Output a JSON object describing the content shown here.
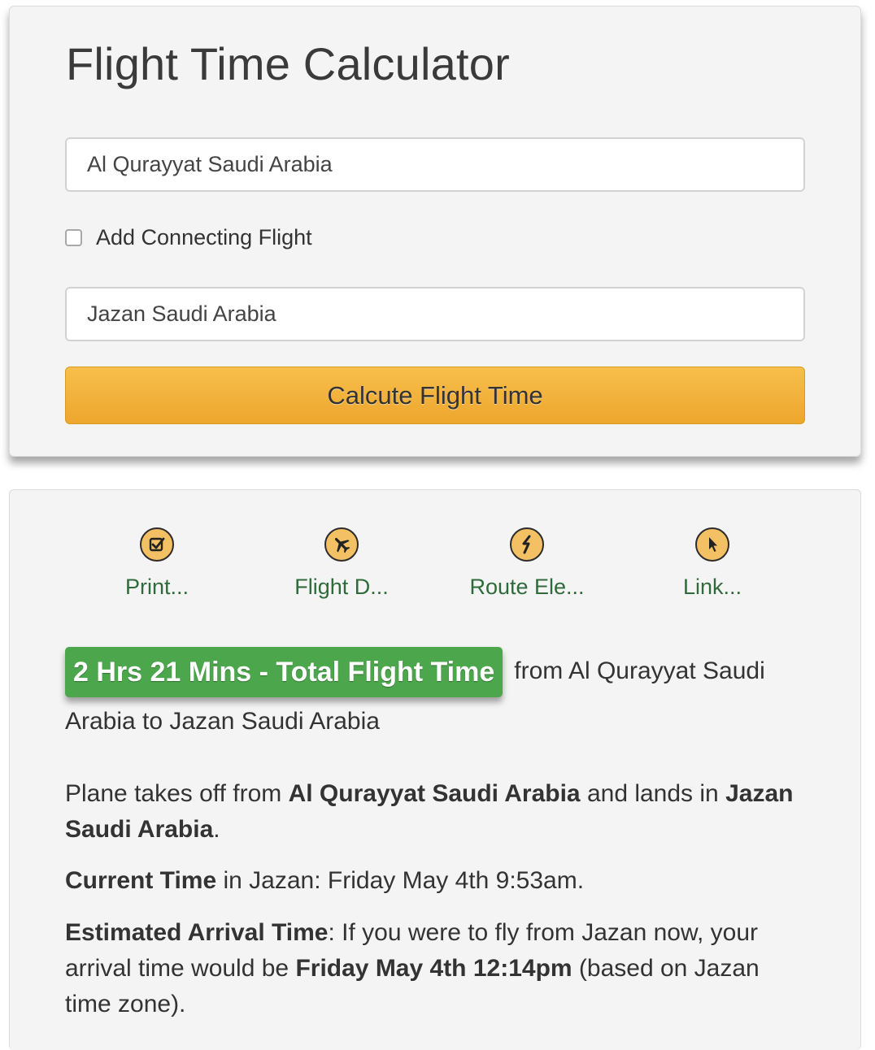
{
  "calculator": {
    "title": "Flight Time Calculator",
    "from_value": "Al Qurayyat Saudi Arabia",
    "connecting_label": "Add Connecting Flight",
    "to_value": "Jazan Saudi Arabia",
    "button_label": "Calcute Flight Time"
  },
  "actions": [
    {
      "label": "Print...",
      "icon": "check-icon"
    },
    {
      "label": "Flight D...",
      "icon": "airplane-icon"
    },
    {
      "label": "Route Ele...",
      "icon": "lightning-icon"
    },
    {
      "label": "Link...",
      "icon": "cursor-icon"
    }
  ],
  "result": {
    "badge": "2 Hrs 21 Mins - Total Flight Time",
    "route_text": "from Al Qurayyat Saudi Arabia to Jazan Saudi Arabia",
    "takeoff_prefix": "Plane takes off from ",
    "takeoff_origin": "Al Qurayyat Saudi Arabia",
    "takeoff_middle": " and lands in ",
    "takeoff_destination": "Jazan Saudi Arabia",
    "takeoff_suffix": ".",
    "current_label": "Current Time",
    "current_text": " in Jazan: Friday May 4th 9:53am.",
    "arrival_label": "Estimated Arrival Time",
    "arrival_text": ": If you were to fly from Jazan now, your arrival time would be ",
    "arrival_time": "Friday May 4th 12:14pm",
    "arrival_suffix": " (based on Jazan time zone)."
  },
  "colors": {
    "accent_button": "#f0ae36",
    "badge_green": "#4ca64c",
    "link_green": "#2f6b3a",
    "icon_fill": "#f4c064"
  }
}
